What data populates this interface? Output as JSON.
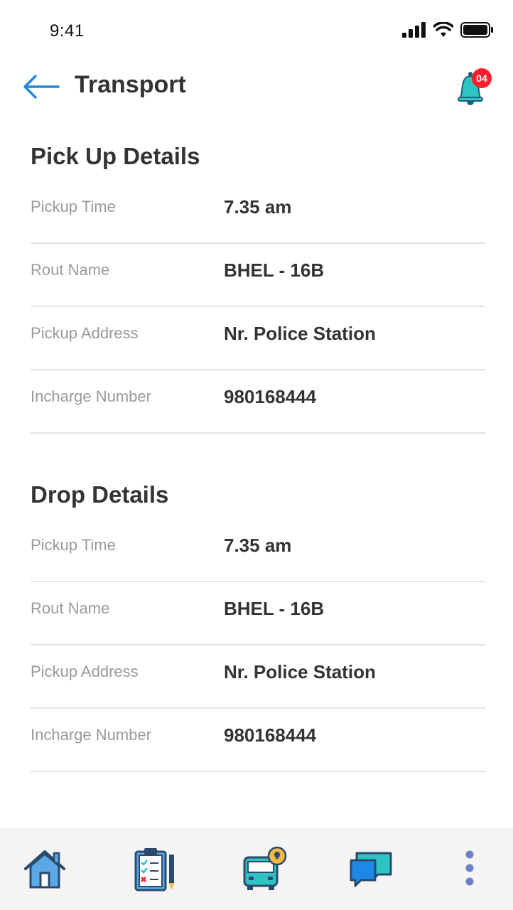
{
  "status_bar": {
    "time": "9:41"
  },
  "header": {
    "title": "Transport",
    "notification_count": "04"
  },
  "pickup": {
    "title": "Pick Up Details",
    "rows": [
      {
        "label": "Pickup Time",
        "value": "7.35 am"
      },
      {
        "label": "Rout Name",
        "value": "BHEL - 16B"
      },
      {
        "label": "Pickup Address",
        "value": "Nr. Police Station"
      },
      {
        "label": "Incharge Number",
        "value": "980168444"
      }
    ]
  },
  "drop": {
    "title": "Drop Details",
    "rows": [
      {
        "label": "Pickup Time",
        "value": "7.35 am"
      },
      {
        "label": "Rout Name",
        "value": "BHEL - 16B"
      },
      {
        "label": "Pickup Address",
        "value": "Nr. Police Station"
      },
      {
        "label": "Incharge Number",
        "value": "980168444"
      }
    ]
  },
  "bottom_nav": {
    "items": [
      {
        "icon": "home-icon"
      },
      {
        "icon": "clipboard-checklist-icon"
      },
      {
        "icon": "bus-location-icon"
      },
      {
        "icon": "chat-icon"
      },
      {
        "icon": "more-vertical-icon"
      }
    ]
  },
  "colors": {
    "accent_blue": "#1e88e5",
    "teal": "#2ec4c4",
    "badge_red": "#ff1e2d",
    "nav_dark": "#2b4a6b",
    "nav_more": "#6f7fc8"
  }
}
